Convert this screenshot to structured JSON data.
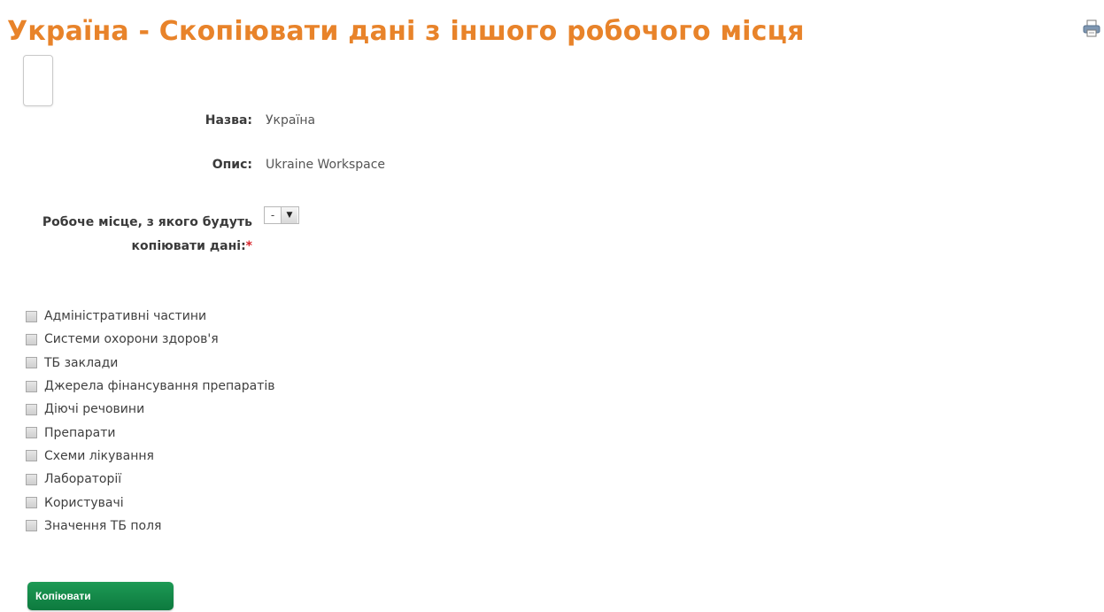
{
  "page": {
    "title": "Україна - Скопіювати дані з іншого робочого місця"
  },
  "toolbar": {
    "print_icon": "print-icon"
  },
  "form": {
    "name_label": "Назва:",
    "name_value": "Україна",
    "description_label": "Опис:",
    "description_value": "Ukraine Workspace",
    "source_label": "Робоче місце, з якого будуть копіювати дані:",
    "required_marker": "*",
    "source_select": {
      "selected": "-",
      "arrow_icon": "chevron-down-icon"
    }
  },
  "options": [
    {
      "label": "Адміністративні частини",
      "checked": false
    },
    {
      "label": "Системи охорони здоров'я",
      "checked": false
    },
    {
      "label": "ТБ заклади",
      "checked": false
    },
    {
      "label": "Джерела фінансування препаратів",
      "checked": false
    },
    {
      "label": "Діючі речовини",
      "checked": false
    },
    {
      "label": "Препарати",
      "checked": false
    },
    {
      "label": "Схеми лікування",
      "checked": false
    },
    {
      "label": "Лабораторії",
      "checked": false
    },
    {
      "label": "Користувачі",
      "checked": false
    },
    {
      "label": "Значення ТБ поля",
      "checked": false
    }
  ],
  "actions": {
    "copy_label": "Копіювати"
  },
  "colors": {
    "title": "#e8832a",
    "button": "#0d7a3e",
    "required": "#d8232a"
  }
}
